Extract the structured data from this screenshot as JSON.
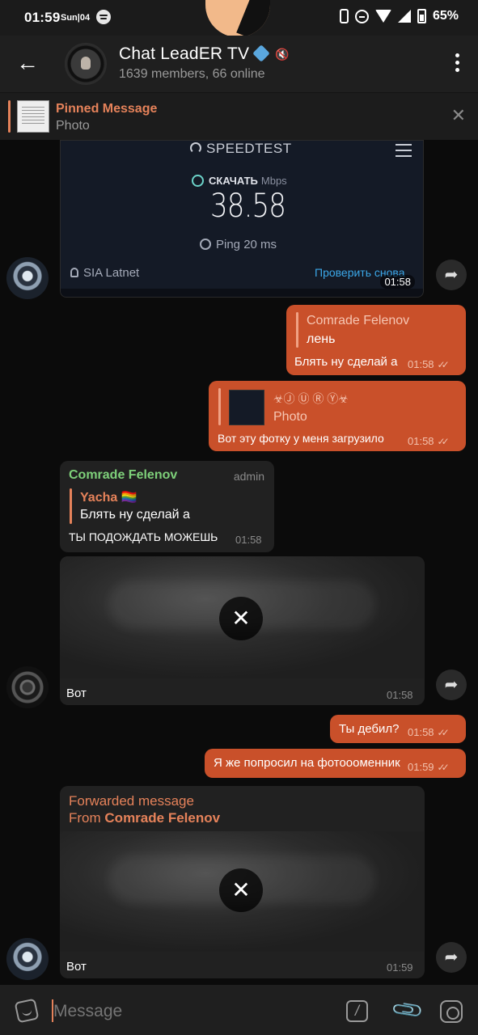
{
  "status_bar": {
    "time": "01:59",
    "date": "Sun|04",
    "battery": "65%"
  },
  "header": {
    "title": "Chat LeadER TV",
    "subtitle": "1639 members, 66 online"
  },
  "pinned": {
    "title": "Pinned Message",
    "subtitle": "Photo"
  },
  "messages": {
    "speedtest": {
      "brand": "SPEEDTEST",
      "download_label": "СКАЧАТЬ",
      "unit": "Mbps",
      "value": "38.58",
      "ping": "Ping 20 ms",
      "isp": "SIA Latnet",
      "check": "Проверить снова",
      "time": "01:58"
    },
    "m1": {
      "reply_name": "Comrade Felenov",
      "reply_text": "лень",
      "text": "Блять ну сделай а",
      "time": "01:58"
    },
    "m2": {
      "reply_name": "☣Ⓙ Ⓤ Ⓡ Ⓨ☣",
      "reply_text": "Photo",
      "text": "Вот эту фотку у меня загрузило",
      "time": "01:58"
    },
    "m3": {
      "sender": "Comrade Felenov",
      "role": "admin",
      "reply_name": "Yacha 🏳️‍🌈",
      "reply_text": "Блять ну сделай а",
      "text": "ТЫ ПОДОЖДАТЬ МОЖЕШЬ",
      "time": "01:58"
    },
    "m4": {
      "caption": "Вот",
      "time": "01:58"
    },
    "m5": {
      "text": "Ты дебил?",
      "time": "01:58"
    },
    "m6": {
      "text": "Я же попросил на фотоооменник",
      "time": "01:59"
    },
    "m7": {
      "forwarded": "Forwarded message",
      "from_label": "From",
      "from_name": "Comrade Felenov",
      "caption": "Вот",
      "time": "01:59"
    }
  },
  "composer": {
    "placeholder": "Message"
  },
  "colors": {
    "accent": "#e5825a",
    "outgoing": "#c9502a",
    "incoming": "#212121",
    "admin_name": "#7ed07a"
  }
}
